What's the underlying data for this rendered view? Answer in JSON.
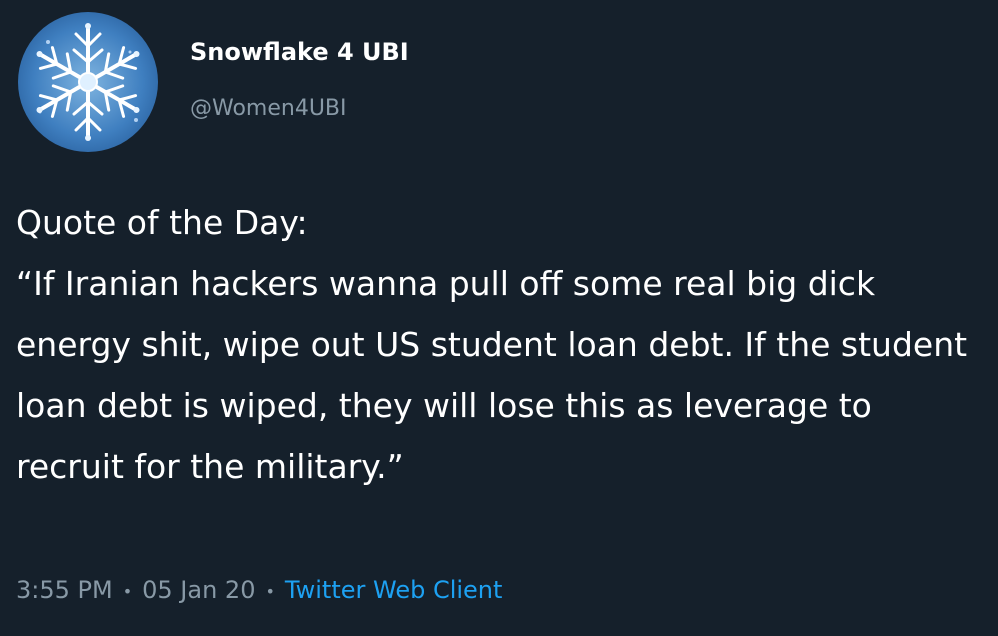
{
  "user": {
    "display_name": "Snowflake 4 UBI",
    "handle": "@Women4UBI",
    "avatar_icon": "snowflake-icon"
  },
  "tweet": {
    "lines": [
      "Quote of the Day:",
      "“If Iranian hackers wanna pull off some real big dick energy shit, wipe out US student loan debt. If the student loan debt is wiped, they will lose this as leverage to recruit for the military.”"
    ]
  },
  "meta": {
    "time": "3:55 PM",
    "date": "05 Jan 20",
    "separator": "•",
    "client": "Twitter Web Client"
  },
  "colors": {
    "background": "#15202b",
    "text": "#ffffff",
    "secondary": "#8899a6",
    "link": "#1da1f2"
  }
}
